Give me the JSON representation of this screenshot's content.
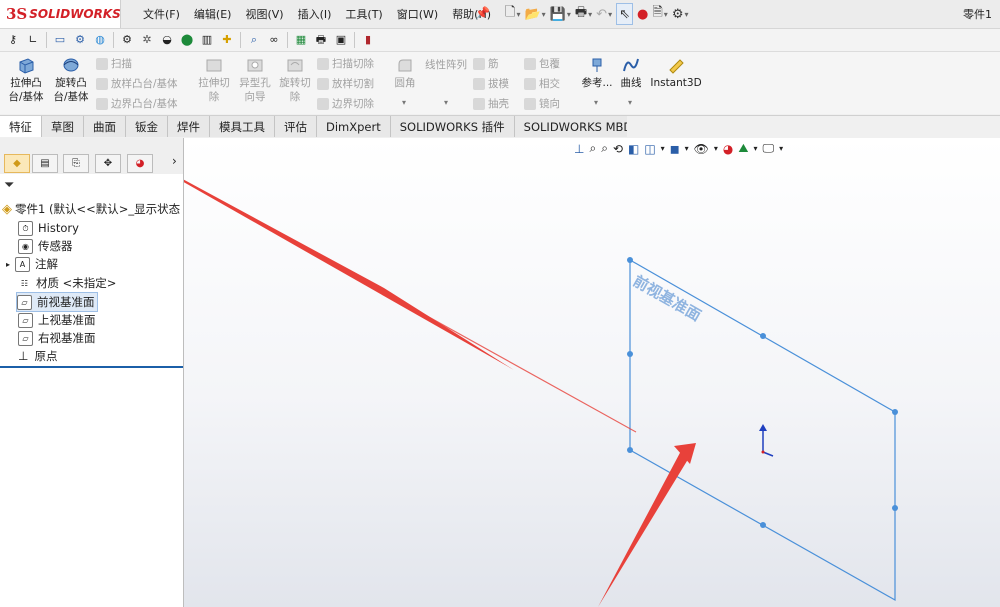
{
  "app": {
    "brand_ds": "3S",
    "brand_name": "SOLIDWORKS",
    "document_name": "零件1"
  },
  "menu": [
    "文件(F)",
    "编辑(E)",
    "视图(V)",
    "插入(I)",
    "工具(T)",
    "窗口(W)",
    "帮助(H)"
  ],
  "features": {
    "extrude_boss": "拉伸凸\n台/基体",
    "revolve_boss": "旋转凸\n台/基体",
    "sweep": "扫描",
    "loft_boss": "放样凸台/基体",
    "boundary_boss": "边界凸台/基体",
    "extrude_cut": "拉伸切\n除",
    "hole_wizard": "异型孔\n向导",
    "revolve_cut": "旋转切\n除",
    "swept_cut": "扫描切除",
    "lofted_cut": "放样切割",
    "boundary_cut": "边界切除",
    "fillet": "圆角",
    "linear_pattern": "线性阵列",
    "rib": "筋",
    "draft": "拔模",
    "shell": "抽壳",
    "wrap": "包覆",
    "intersect": "相交",
    "mirror": "镜向",
    "reference": "参考...",
    "curves": "曲线",
    "instant3d": "Instant3D"
  },
  "tabs": [
    "特征",
    "草图",
    "曲面",
    "钣金",
    "焊件",
    "模具工具",
    "评估",
    "DimXpert",
    "SOLIDWORKS 插件",
    "SOLIDWORKS MBD"
  ],
  "tree": {
    "root": "零件1 (默认<<默认>_显示状态",
    "items": [
      "History",
      "传感器",
      "注解",
      "材质 <未指定>",
      "前视基准面",
      "上视基准面",
      "右视基准面",
      "原点"
    ]
  },
  "viewport": {
    "plane_label": "前视基准面"
  },
  "colors": {
    "brand_red": "#d32027",
    "plane_blue": "#4a90d9",
    "arrow_red": "#e8413a",
    "tab_active": "#ffffff"
  }
}
